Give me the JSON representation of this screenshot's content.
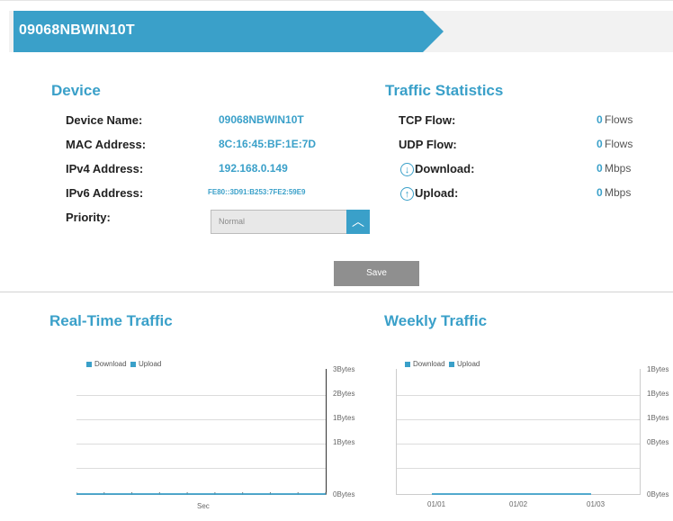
{
  "colors": {
    "accent": "#3aa0c9",
    "save_button": "#8f8f8f",
    "text": "#222222"
  },
  "header": {
    "device_tab_title": "09068NBWIN10T"
  },
  "device": {
    "title": "Device",
    "rows": [
      {
        "label": "Device Name:",
        "value": "09068NBWIN10T"
      },
      {
        "label": "MAC Address:",
        "value": "8C:16:45:BF:1E:7D"
      },
      {
        "label": "IPv4 Address:",
        "value": "192.168.0.149"
      },
      {
        "label": "IPv6 Address:",
        "value": "FE80::3D91:B253:7FE2:59E9"
      }
    ],
    "priority_label": "Priority:",
    "priority_selected": "Normal"
  },
  "traffic_stats": {
    "title": "Traffic Statistics",
    "rows": [
      {
        "label": "TCP Flow:",
        "value": "0",
        "unit": "Flows",
        "icon": ""
      },
      {
        "label": "UDP Flow:",
        "value": "0",
        "unit": "Flows",
        "icon": ""
      },
      {
        "label": "Download:",
        "value": "0",
        "unit": "Mbps",
        "icon": "download-icon"
      },
      {
        "label": "Upload:",
        "value": "0",
        "unit": "Mbps",
        "icon": "upload-icon"
      }
    ]
  },
  "save_label": "Save",
  "realtime": {
    "title": "Real-Time Traffic",
    "legend": [
      "Download",
      "Upload"
    ],
    "y_ticks": [
      "3Bytes",
      "2Bytes",
      "1Bytes",
      "1Bytes",
      "0Bytes"
    ],
    "x_label": "Sec"
  },
  "weekly": {
    "title": "Weekly Traffic",
    "legend": [
      "Download",
      "Upload"
    ],
    "y_ticks": [
      "1Bytes",
      "1Bytes",
      "1Bytes",
      "0Bytes",
      "0Bytes"
    ],
    "x_ticks": [
      "01/01",
      "01/02",
      "01/03"
    ]
  },
  "chart_data": [
    {
      "type": "line",
      "title": "Real-Time Traffic",
      "xlabel": "Sec",
      "ylabel": "",
      "y_tick_labels": [
        "3Bytes",
        "2Bytes",
        "1Bytes",
        "1Bytes",
        "0Bytes"
      ],
      "series": [
        {
          "name": "Download",
          "values": [
            0,
            0,
            0,
            0,
            0,
            0,
            0,
            0,
            0,
            0
          ]
        },
        {
          "name": "Upload",
          "values": [
            0,
            0,
            0,
            0,
            0,
            0,
            0,
            0,
            0,
            0
          ]
        }
      ],
      "legend": "top-left",
      "grid": true
    },
    {
      "type": "line",
      "title": "Weekly Traffic",
      "categories": [
        "01/01",
        "01/02",
        "01/03"
      ],
      "y_tick_labels": [
        "1Bytes",
        "1Bytes",
        "1Bytes",
        "0Bytes",
        "0Bytes"
      ],
      "series": [
        {
          "name": "Download",
          "values": [
            0,
            0,
            0
          ]
        },
        {
          "name": "Upload",
          "values": [
            0,
            0,
            0
          ]
        }
      ],
      "legend": "top-left",
      "grid": true
    }
  ]
}
